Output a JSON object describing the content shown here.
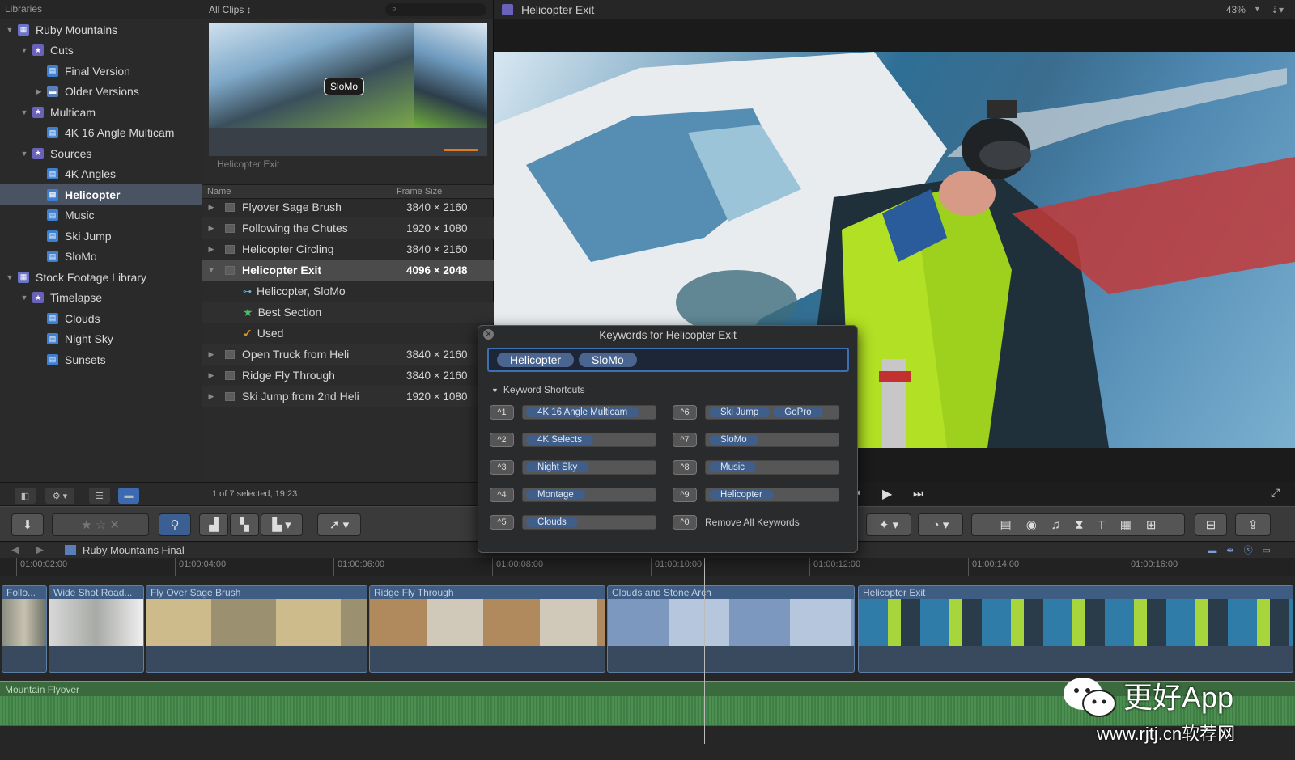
{
  "libraries": {
    "header": "Libraries",
    "items": [
      {
        "label": "Ruby Mountains",
        "kind": "library",
        "depth": 0,
        "disclosure": "▼"
      },
      {
        "label": "Cuts",
        "kind": "event",
        "depth": 1,
        "disclosure": "▼"
      },
      {
        "label": "Final Version",
        "kind": "project",
        "depth": 2,
        "disclosure": ""
      },
      {
        "label": "Older Versions",
        "kind": "folder",
        "depth": 2,
        "disclosure": "▶"
      },
      {
        "label": "Multicam",
        "kind": "event",
        "depth": 1,
        "disclosure": "▼"
      },
      {
        "label": "4K 16 Angle Multicam",
        "kind": "project",
        "depth": 2,
        "disclosure": ""
      },
      {
        "label": "Sources",
        "kind": "event",
        "depth": 1,
        "disclosure": "▼"
      },
      {
        "label": "4K Angles",
        "kind": "project",
        "depth": 2,
        "disclosure": ""
      },
      {
        "label": "Helicopter",
        "kind": "project",
        "depth": 2,
        "disclosure": "",
        "selected": true
      },
      {
        "label": "Music",
        "kind": "project",
        "depth": 2,
        "disclosure": ""
      },
      {
        "label": "Ski Jump",
        "kind": "project",
        "depth": 2,
        "disclosure": ""
      },
      {
        "label": "SloMo",
        "kind": "project",
        "depth": 2,
        "disclosure": ""
      },
      {
        "label": "Stock Footage Library",
        "kind": "library",
        "depth": 0,
        "disclosure": "▼"
      },
      {
        "label": "Timelapse",
        "kind": "event",
        "depth": 1,
        "disclosure": "▼"
      },
      {
        "label": "Clouds",
        "kind": "project",
        "depth": 2,
        "disclosure": ""
      },
      {
        "label": "Night Sky",
        "kind": "project",
        "depth": 2,
        "disclosure": ""
      },
      {
        "label": "Sunsets",
        "kind": "project",
        "depth": 2,
        "disclosure": ""
      }
    ]
  },
  "browser": {
    "filter": "All Clips ↕",
    "thumb_tag": "SloMo",
    "thumb_label": "Helicopter Exit",
    "col_name": "Name",
    "col_frame": "Frame Size",
    "rows": [
      {
        "name": "Flyover Sage Brush",
        "frame": "3840 × 2160",
        "type": "clip"
      },
      {
        "name": "Following the Chutes",
        "frame": "1920 × 1080",
        "type": "clip"
      },
      {
        "name": "Helicopter Circling",
        "frame": "3840 × 2160",
        "type": "clip"
      },
      {
        "name": "Helicopter Exit",
        "frame": "4096 × 2048",
        "type": "clip",
        "selected": true,
        "expanded": true
      },
      {
        "name": "Helicopter, SloMo",
        "frame": "",
        "type": "keyword"
      },
      {
        "name": "Best Section",
        "frame": "",
        "type": "favorite"
      },
      {
        "name": "Used",
        "frame": "",
        "type": "used"
      },
      {
        "name": "Open Truck from Heli",
        "frame": "3840 × 2160",
        "type": "clip"
      },
      {
        "name": "Ridge Fly Through",
        "frame": "3840 × 2160",
        "type": "clip"
      },
      {
        "name": "Ski Jump from 2nd Heli",
        "frame": "1920 × 1080",
        "type": "clip"
      }
    ],
    "status": "1 of 7 selected, 19:23"
  },
  "viewer": {
    "title": "Helicopter Exit",
    "zoom": "43%"
  },
  "keywords_dialog": {
    "title": "Keywords for Helicopter Exit",
    "tokens": [
      "Helicopter",
      "SloMo"
    ],
    "shortcuts_label": "Keyword Shortcuts",
    "left": [
      {
        "key": "^1",
        "tags": [
          "4K 16 Angle Multicam"
        ]
      },
      {
        "key": "^2",
        "tags": [
          "4K Selects"
        ]
      },
      {
        "key": "^3",
        "tags": [
          "Night Sky"
        ]
      },
      {
        "key": "^4",
        "tags": [
          "Montage"
        ]
      },
      {
        "key": "^5",
        "tags": [
          "Clouds"
        ]
      }
    ],
    "right": [
      {
        "key": "^6",
        "tags": [
          "Ski Jump",
          "GoPro"
        ]
      },
      {
        "key": "^7",
        "tags": [
          "SloMo"
        ]
      },
      {
        "key": "^8",
        "tags": [
          "Music"
        ]
      },
      {
        "key": "^9",
        "tags": [
          "Helicopter"
        ]
      },
      {
        "key": "^0",
        "tags": []
      }
    ],
    "remove_all": "Remove All Keywords"
  },
  "timeline": {
    "project": "Ruby Mountains Final",
    "ticks": [
      "01:00:02:00",
      "01:00:04:00",
      "01:00:06:00",
      "01:00:08:00",
      "01:00:10:00",
      "01:00:12:00",
      "01:00:14:00",
      "01:00:16:00"
    ],
    "clips": [
      {
        "label": "Follo..."
      },
      {
        "label": "Wide Shot Road..."
      },
      {
        "label": "Fly Over Sage Brush"
      },
      {
        "label": "Ridge Fly Through"
      },
      {
        "label": "Clouds and Stone Arch"
      },
      {
        "label": "Helicopter Exit"
      }
    ],
    "audio_label": "Mountain Flyover"
  },
  "watermark": {
    "brand": "更好App",
    "url": "www.rjtj.cn软荐网"
  },
  "colors": {
    "accent": "#3c5f93",
    "selection": "#4a5362",
    "clip": "#394a5f",
    "audio": "#3a6a3d"
  }
}
